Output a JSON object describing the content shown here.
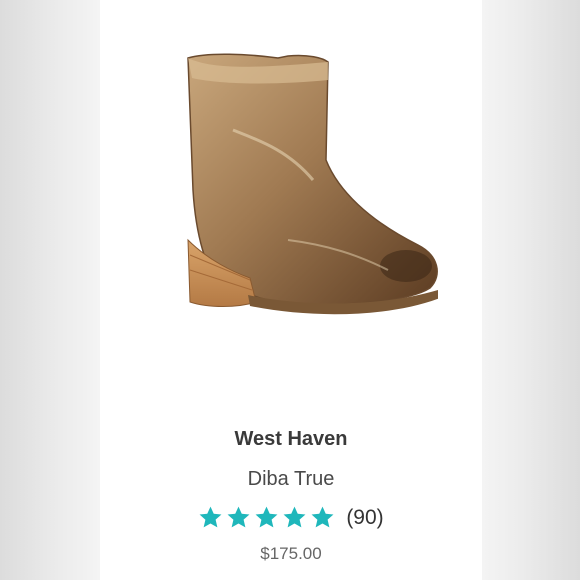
{
  "product": {
    "name": "West Haven",
    "brand": "Diba True",
    "rating": 5,
    "rating_max": 5,
    "review_count": "(90)",
    "price": "$175.00",
    "image_icon": "ankle-boot"
  },
  "colors": {
    "star": "#1fb7bb",
    "card_background": "#ffffff",
    "title_text": "#3a3a3a",
    "price_text": "#666666"
  }
}
